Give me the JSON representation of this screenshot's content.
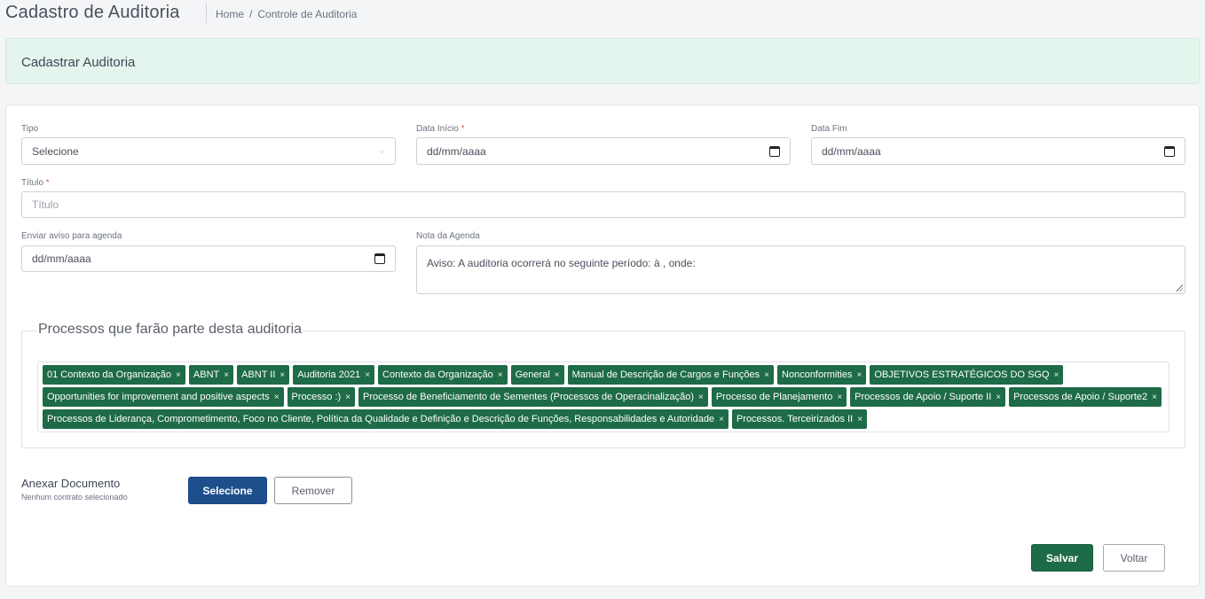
{
  "header": {
    "title": "Cadastro de Auditoria",
    "breadcrumb": [
      "Home",
      "/",
      "Controle de Auditoria"
    ]
  },
  "banner": {
    "title": "Cadastrar Auditoria"
  },
  "form": {
    "tipo": {
      "label": "Tipo",
      "value": "Selecione"
    },
    "data_inicio": {
      "label": "Data Início",
      "required_mark": "*",
      "value": "dd/mm/aaaa"
    },
    "data_fim": {
      "label": "Data Fim",
      "value": "dd/mm/aaaa"
    },
    "titulo": {
      "label": "Título",
      "required_mark": "*",
      "placeholder": "Título"
    },
    "enviar_aviso": {
      "label": "Enviar aviso para agenda",
      "value": "dd/mm/aaaa"
    },
    "nota_agenda": {
      "label": "Nota da Agenda",
      "value": "Aviso: A auditoria ocorrerá no seguinte período:  à , onde:"
    }
  },
  "processos": {
    "legend": "Processos que farão parte desta auditoria",
    "remove_glyph": "×",
    "tags": [
      "01 Contexto da Organização",
      "ABNT",
      "ABNT II",
      "Auditoria 2021",
      "Contexto da Organização",
      "General",
      "Manual de Descrição de Cargos e Funções",
      "Nonconformities",
      "OBJETIVOS ESTRATÉGICOS DO SGQ",
      "Opportunities for improvement and positive aspects",
      "Processo :)",
      "Processo de Beneficiamento de Sementes (Processos de Operacinalização)",
      "Processo de Planejamento",
      "Processos de Apoio / Suporte II",
      "Processos de Apoio / Suporte2",
      "Processos de Liderança, Comprometimento, Foco no Cliente, Política da Qualidade e Definição e Descrição de Funções, Responsabilidades e Autoridade",
      "Processos. Terceirizados II"
    ]
  },
  "anexo": {
    "label": "Anexar Documento",
    "status": "Nenhum contrato selecionado",
    "select_label": "Selecione",
    "remove_label": "Remover"
  },
  "actions": {
    "save_label": "Salvar",
    "back_label": "Voltar"
  },
  "icons": {
    "select": "chevron-down-icon",
    "date": "calendar-icon",
    "tag_remove": "close-icon"
  },
  "colors": {
    "primary_green": "#1e6b47",
    "primary_blue": "#1e4f8c",
    "banner_bg": "#e3f5ec"
  }
}
